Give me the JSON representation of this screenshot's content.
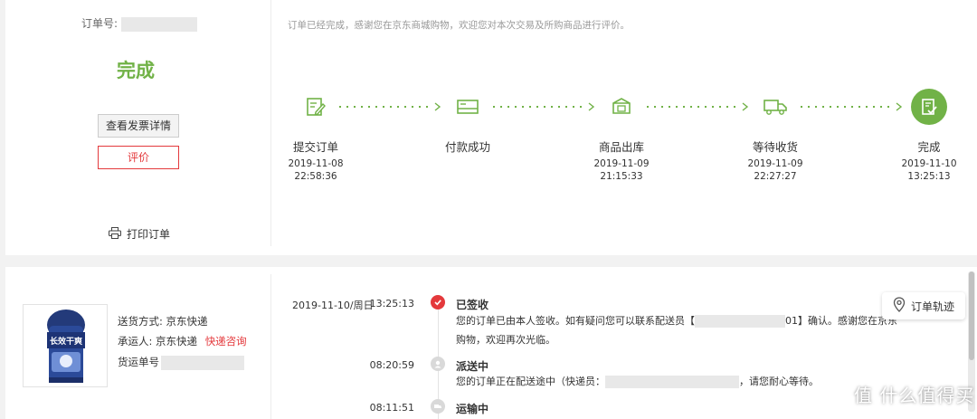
{
  "order": {
    "number_label": "订单号:",
    "status": "完成",
    "invoice_button": "查看发票详情",
    "review_button": "评价",
    "print_label": "打印订单"
  },
  "message": "订单已经完成，感谢您在京东商城购物，欢迎您对本次交易及所购商品进行评价。",
  "steps": [
    {
      "icon": "submit-order-icon",
      "label": "提交订单",
      "date": "2019-11-08",
      "time": "22:58:36"
    },
    {
      "icon": "payment-icon",
      "label": "付款成功",
      "date": "",
      "time": ""
    },
    {
      "icon": "outbound-box-icon",
      "label": "商品出库",
      "date": "2019-11-09",
      "time": "21:15:33"
    },
    {
      "icon": "delivery-truck-icon",
      "label": "等待收货",
      "date": "2019-11-09",
      "time": "22:27:27"
    },
    {
      "icon": "completed-check-icon",
      "label": "完成",
      "date": "2019-11-10",
      "time": "13:25:13"
    }
  ],
  "shipping": {
    "method_label": "送货方式:",
    "method_value": "京东快递",
    "carrier_label": "承运人:",
    "carrier_value": "京东快递",
    "carrier_link": "快递咨询",
    "tracking_label": "货运单号"
  },
  "timeline": {
    "date": "2019-11-10/周日",
    "events": [
      {
        "time": "13:25:13",
        "status": "已签收",
        "text_line1_start": "您的订单已由本人签收。如有疑问您可以联系配送员【",
        "text_line1_end": "01】确认。感谢您在京东",
        "text_line2": "购物，欢迎再次光临。"
      },
      {
        "time": "08:20:59",
        "status": "派送中",
        "text_start": "您的订单正在配送途中（快递员：",
        "text_end": "，请您耐心等待。"
      },
      {
        "time": "08:11:51",
        "status": "运输中"
      }
    ]
  },
  "track_button": "订单轨迹",
  "product_image_text": "长效干爽",
  "watermark": "值 什么值得买",
  "colors": {
    "accent_green": "#71b247",
    "accent_red": "#e4393c",
    "mask_gray": "#e8e8e8"
  }
}
